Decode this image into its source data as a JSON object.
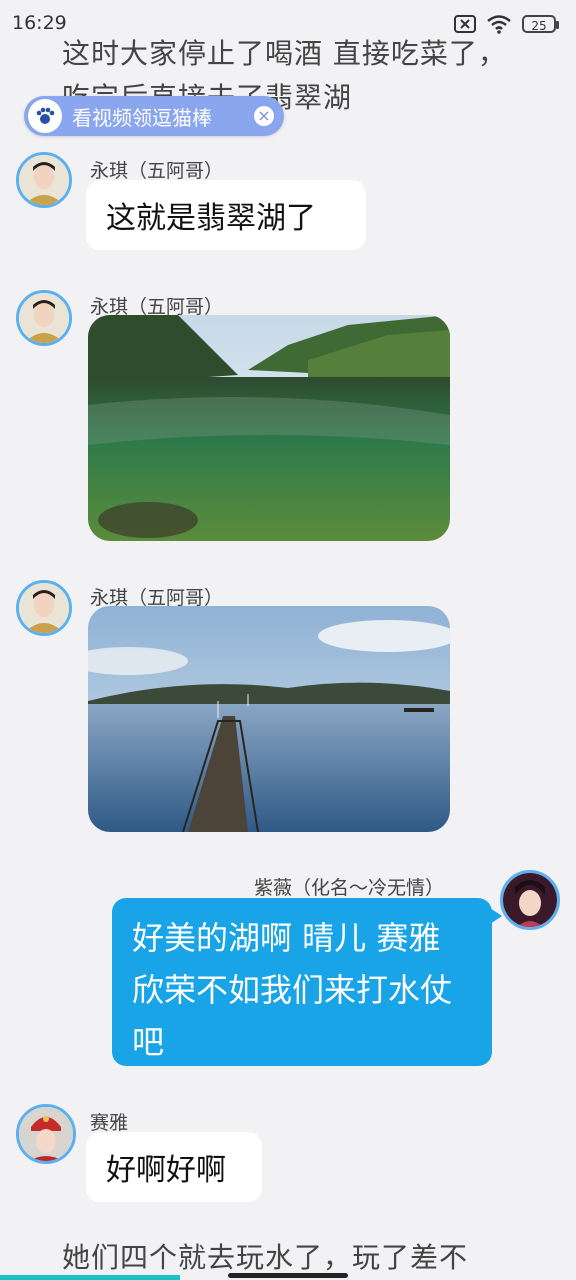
{
  "status_bar": {
    "time": "16:29",
    "battery": "25"
  },
  "narration_top": "这时大家停止了喝酒 直接吃菜了，吃完后直接去了翡翠湖",
  "promo": {
    "label": "看视频领逗猫棒",
    "close": "×"
  },
  "messages": [
    {
      "sender": "永琪（五阿哥）",
      "text": "这就是翡翠湖了"
    },
    {
      "sender": "永琪（五阿哥）",
      "image": "emerald-lake-photo"
    },
    {
      "sender": "永琪（五阿哥）",
      "image": "lake-pier-photo"
    },
    {
      "sender": "紫薇（化名～冷无情）",
      "text": "好美的湖啊  晴儿 赛雅 欣荣不如我们来打水仗吧"
    },
    {
      "sender": "赛雅",
      "text": "好啊好啊"
    }
  ],
  "narration_bottom": "她们四个就去玩水了，玩了差不",
  "colors": {
    "background": "#f2f2f4",
    "accent_bubble": "#19a4e8",
    "avatar_ring": "#5ab0f0",
    "promo": "#8aa6ee"
  }
}
